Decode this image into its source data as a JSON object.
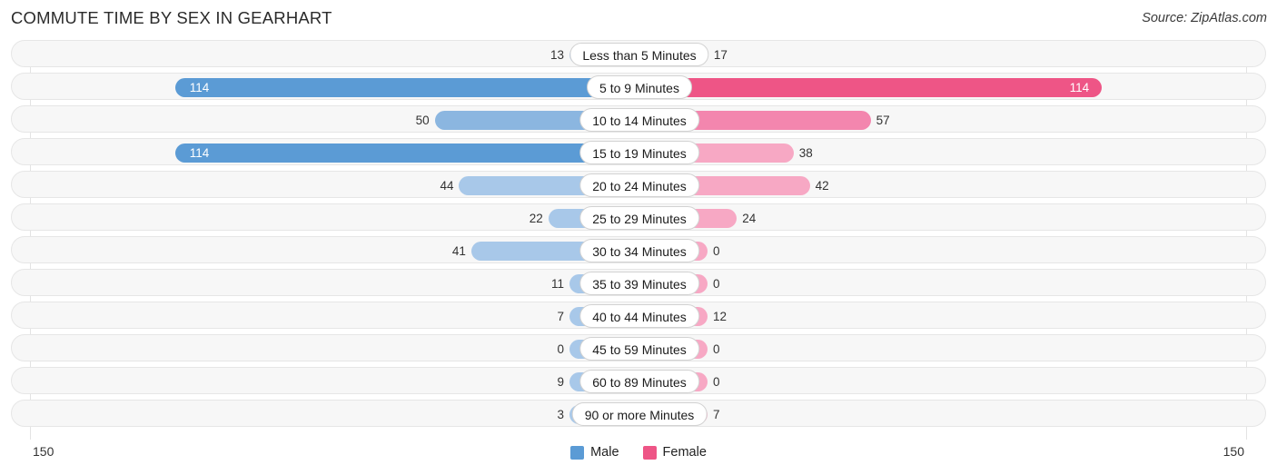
{
  "header": {
    "title": "COMMUTE TIME BY SEX IN GEARHART",
    "source": "Source: ZipAtlas.com"
  },
  "axis": {
    "left_label": "150",
    "right_label": "150",
    "max": 150
  },
  "legend": {
    "items": [
      {
        "label": "Male",
        "color": "#5b9bd5"
      },
      {
        "label": "Female",
        "color": "#ee5586"
      }
    ]
  },
  "colors": {
    "male_light": "#a8c8e9",
    "male_mid": "#8bb6e0",
    "male_strong": "#5b9bd5",
    "female_light": "#f7a8c4",
    "female_mid": "#f386ae",
    "female_strong": "#ee5586",
    "track_bg": "#f7f7f7",
    "track_border": "#e6e6e6",
    "grid": "#e3e3e3"
  },
  "chart_data": {
    "type": "bar",
    "title": "COMMUTE TIME BY SEX IN GEARHART",
    "subtitle": "",
    "orientation": "horizontal-diverging",
    "xlabel": "",
    "ylabel": "",
    "xlim": [
      150,
      150
    ],
    "grid": true,
    "legend_position": "bottom-center",
    "categories": [
      "Less than 5 Minutes",
      "5 to 9 Minutes",
      "10 to 14 Minutes",
      "15 to 19 Minutes",
      "20 to 24 Minutes",
      "25 to 29 Minutes",
      "30 to 34 Minutes",
      "35 to 39 Minutes",
      "40 to 44 Minutes",
      "45 to 59 Minutes",
      "60 to 89 Minutes",
      "90 or more Minutes"
    ],
    "series": [
      {
        "name": "Male",
        "values": [
          13,
          114,
          50,
          114,
          44,
          22,
          41,
          11,
          7,
          0,
          9,
          3
        ]
      },
      {
        "name": "Female",
        "values": [
          17,
          114,
          57,
          38,
          42,
          24,
          0,
          0,
          12,
          0,
          0,
          7
        ]
      }
    ]
  },
  "rows": [
    {
      "label": "Less than 5 Minutes",
      "male": "13",
      "female": "17",
      "male_val": 13,
      "female_val": 17
    },
    {
      "label": "5 to 9 Minutes",
      "male": "114",
      "female": "114",
      "male_val": 114,
      "female_val": 114
    },
    {
      "label": "10 to 14 Minutes",
      "male": "50",
      "female": "57",
      "male_val": 50,
      "female_val": 57
    },
    {
      "label": "15 to 19 Minutes",
      "male": "114",
      "female": "38",
      "male_val": 114,
      "female_val": 38
    },
    {
      "label": "20 to 24 Minutes",
      "male": "44",
      "female": "42",
      "male_val": 44,
      "female_val": 42
    },
    {
      "label": "25 to 29 Minutes",
      "male": "22",
      "female": "24",
      "male_val": 22,
      "female_val": 24
    },
    {
      "label": "30 to 34 Minutes",
      "male": "41",
      "female": "0",
      "male_val": 41,
      "female_val": 0
    },
    {
      "label": "35 to 39 Minutes",
      "male": "11",
      "female": "0",
      "male_val": 11,
      "female_val": 0
    },
    {
      "label": "40 to 44 Minutes",
      "male": "7",
      "female": "12",
      "male_val": 7,
      "female_val": 12
    },
    {
      "label": "45 to 59 Minutes",
      "male": "0",
      "female": "0",
      "male_val": 0,
      "female_val": 0
    },
    {
      "label": "60 to 89 Minutes",
      "male": "9",
      "female": "0",
      "male_val": 9,
      "female_val": 0
    },
    {
      "label": "90 or more Minutes",
      "male": "3",
      "female": "7",
      "male_val": 3,
      "female_val": 7
    }
  ]
}
